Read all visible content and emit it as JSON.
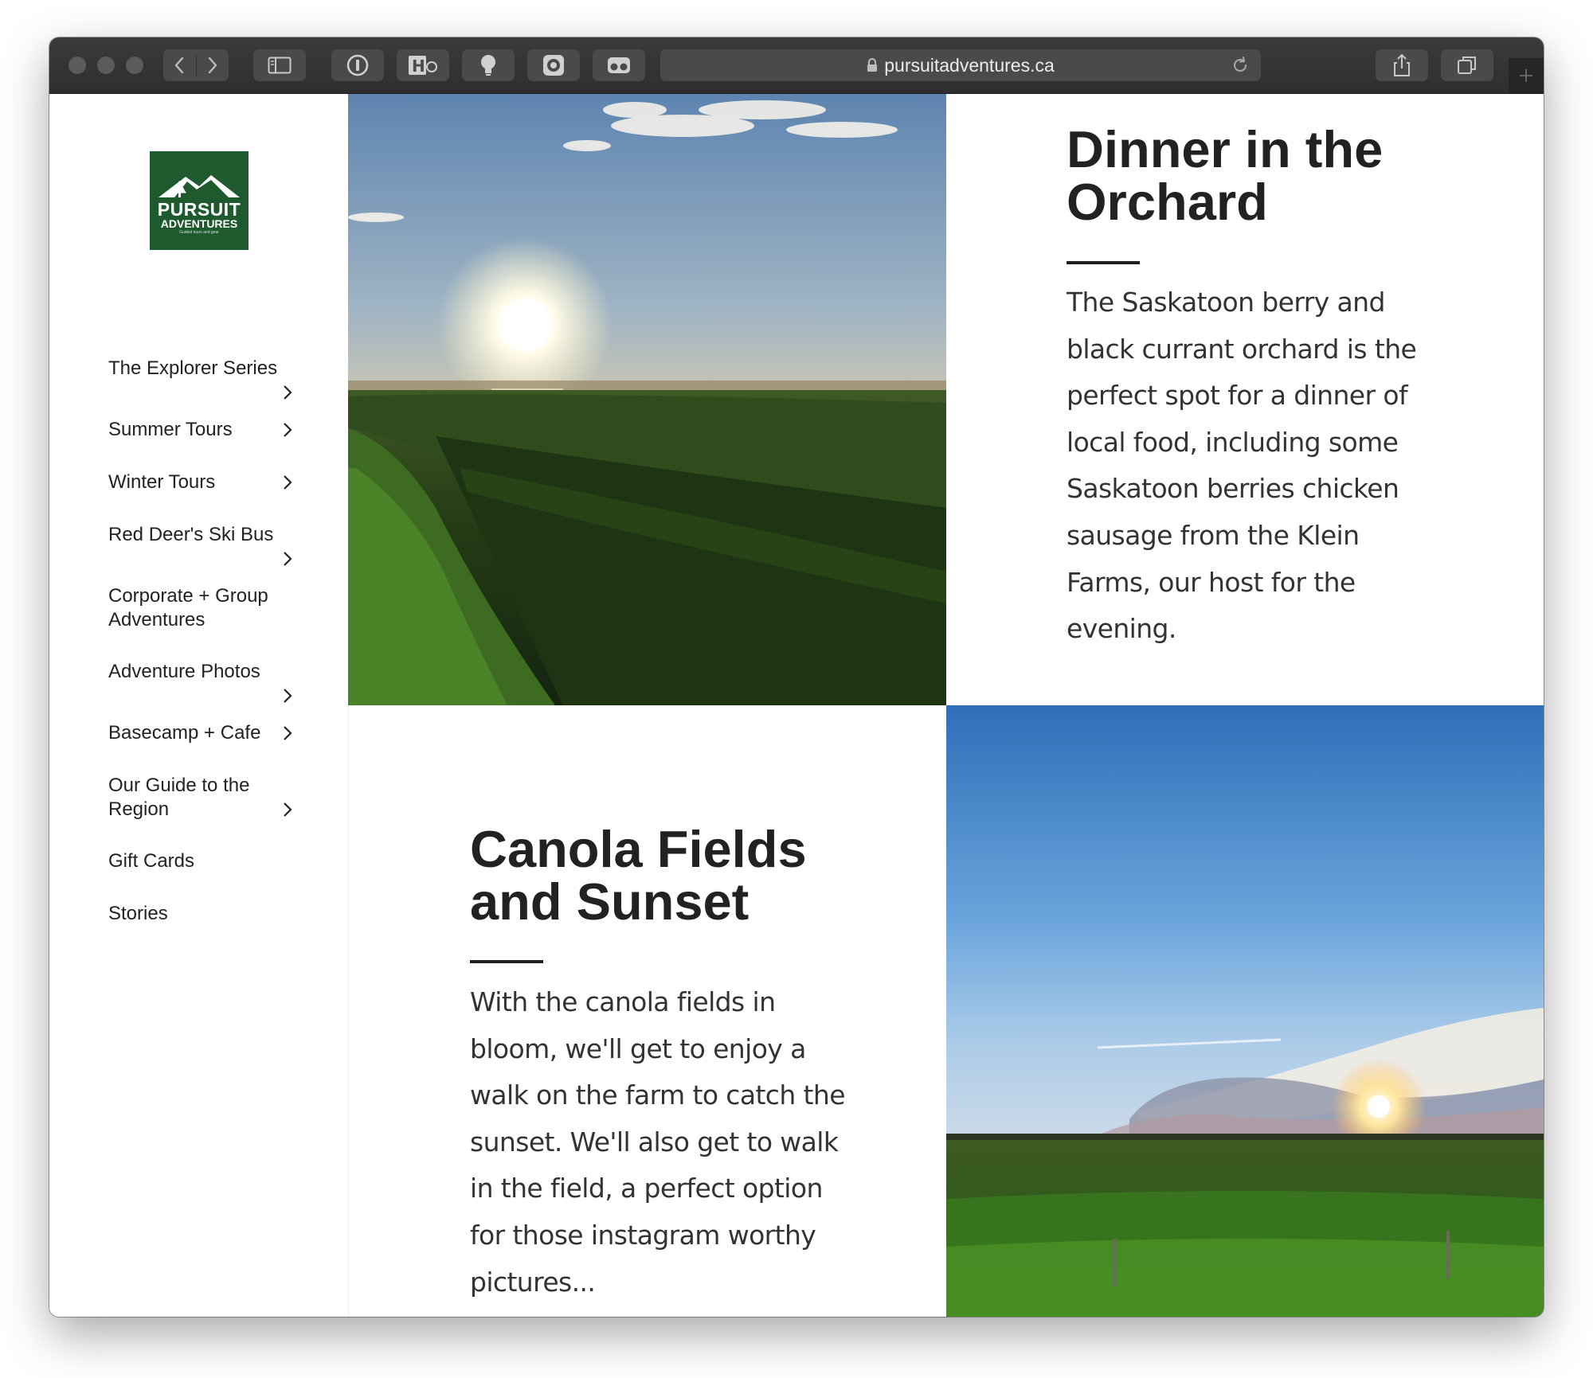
{
  "browser": {
    "url": "pursuitadventures.ca"
  },
  "logo": {
    "line1": "PURSUIT",
    "line2": "ADVENTURES",
    "tagline": "Guided tours and gear"
  },
  "nav": {
    "items": [
      {
        "label": "The Explorer Series"
      },
      {
        "label": "Summer Tours"
      },
      {
        "label": "Winter Tours"
      },
      {
        "label": "Red Deer's Ski Bus"
      },
      {
        "label": "Corporate + Group Adventures"
      },
      {
        "label": "Adventure Photos"
      },
      {
        "label": "Basecamp + Cafe"
      },
      {
        "label": "Our Guide to the Region"
      },
      {
        "label": "Gift Cards"
      },
      {
        "label": "Stories"
      }
    ]
  },
  "cards": {
    "orchard": {
      "title": "Dinner in the Orchard",
      "body": "The Saskatoon berry and black currant orchard is the perfect spot for a dinner of local food, including some Saskatoon berries chicken sausage from the Klein Farms, our host for the evening."
    },
    "canola": {
      "title": "Canola Fields and Sunset",
      "body": "With the canola fields in bloom, we'll get to enjoy a walk on the farm to catch the sunset. We'll also get to walk in the field, a perfect option for those instagram worthy pictures..."
    }
  },
  "colors": {
    "logo_green": "#1f5a2f",
    "toolbar": "#363638",
    "heading": "#222222"
  }
}
